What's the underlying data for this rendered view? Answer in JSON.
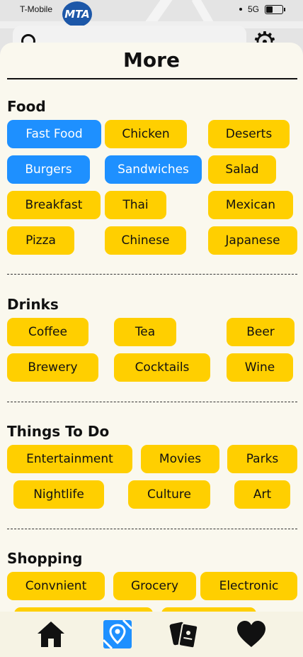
{
  "status": {
    "carrier": "T-Mobile",
    "network": "5G"
  },
  "background": {
    "mta_logo": "MTA"
  },
  "sheet": {
    "title": "More"
  },
  "sections": {
    "food": {
      "title": "Food",
      "chips": [
        "Fast Food",
        "Chicken",
        "Deserts",
        "Burgers",
        "Sandwiches",
        "Salad",
        "Breakfast",
        "Thai",
        "Mexican",
        "Pizza",
        "Chinese",
        "Japanese"
      ],
      "selected": [
        "Fast Food",
        "Burgers",
        "Sandwiches"
      ]
    },
    "drinks": {
      "title": "Drinks",
      "chips": [
        "Coffee",
        "Tea",
        "Beer",
        "Brewery",
        "Cocktails",
        "Wine"
      ]
    },
    "things_to_do": {
      "title": "Things To Do",
      "chips": [
        "Entertainment",
        "Movies",
        "Parks",
        "Nightlife",
        "Culture",
        "Art"
      ]
    },
    "shopping": {
      "title": "Shopping",
      "chips": [
        "Convnient",
        "Grocery",
        "Electronic"
      ]
    }
  },
  "tab_bar": {
    "tabs": [
      {
        "icon": "home-icon"
      },
      {
        "icon": "map-pin-icon",
        "active": true
      },
      {
        "icon": "cards-icon"
      },
      {
        "icon": "heart-icon"
      }
    ]
  },
  "colors": {
    "chip": "#ffcf00",
    "chip_selected": "#1e90ff",
    "sheet_bg": "#faf8ee",
    "active_tab": "#1e90ff"
  }
}
